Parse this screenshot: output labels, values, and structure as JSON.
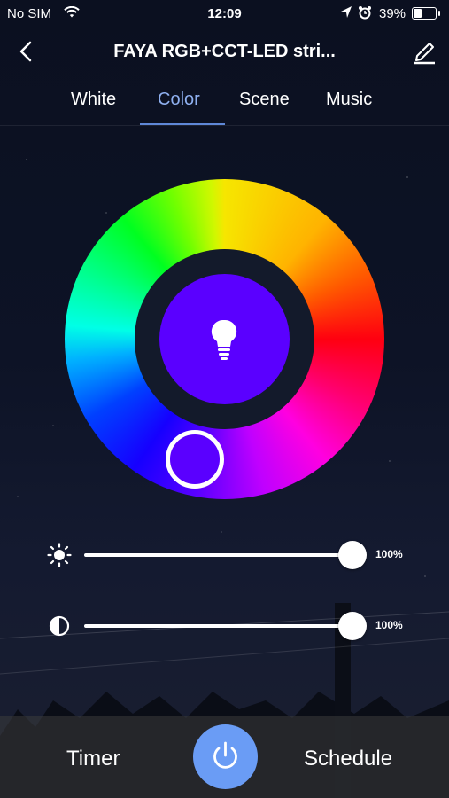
{
  "status": {
    "carrier": "No SIM",
    "time": "12:09",
    "battery": "39%"
  },
  "nav": {
    "title": "FAYA RGB+CCT-LED stri...",
    "back_icon": "chevron-left-icon",
    "edit_icon": "pencil-icon"
  },
  "tabs": [
    {
      "label": "White"
    },
    {
      "label": "Color",
      "active": true
    },
    {
      "label": "Scene"
    },
    {
      "label": "Music"
    }
  ],
  "color": {
    "selected": "#5a00ff",
    "active_tab_color": "#8fb0f0"
  },
  "sliders": {
    "brightness": {
      "value": 100,
      "label": "100%",
      "icon": "sun-icon"
    },
    "saturation": {
      "value": 100,
      "label": "100%",
      "icon": "contrast-icon"
    }
  },
  "bottom": {
    "timer": "Timer",
    "schedule": "Schedule",
    "power_color": "#6a9cf5"
  }
}
